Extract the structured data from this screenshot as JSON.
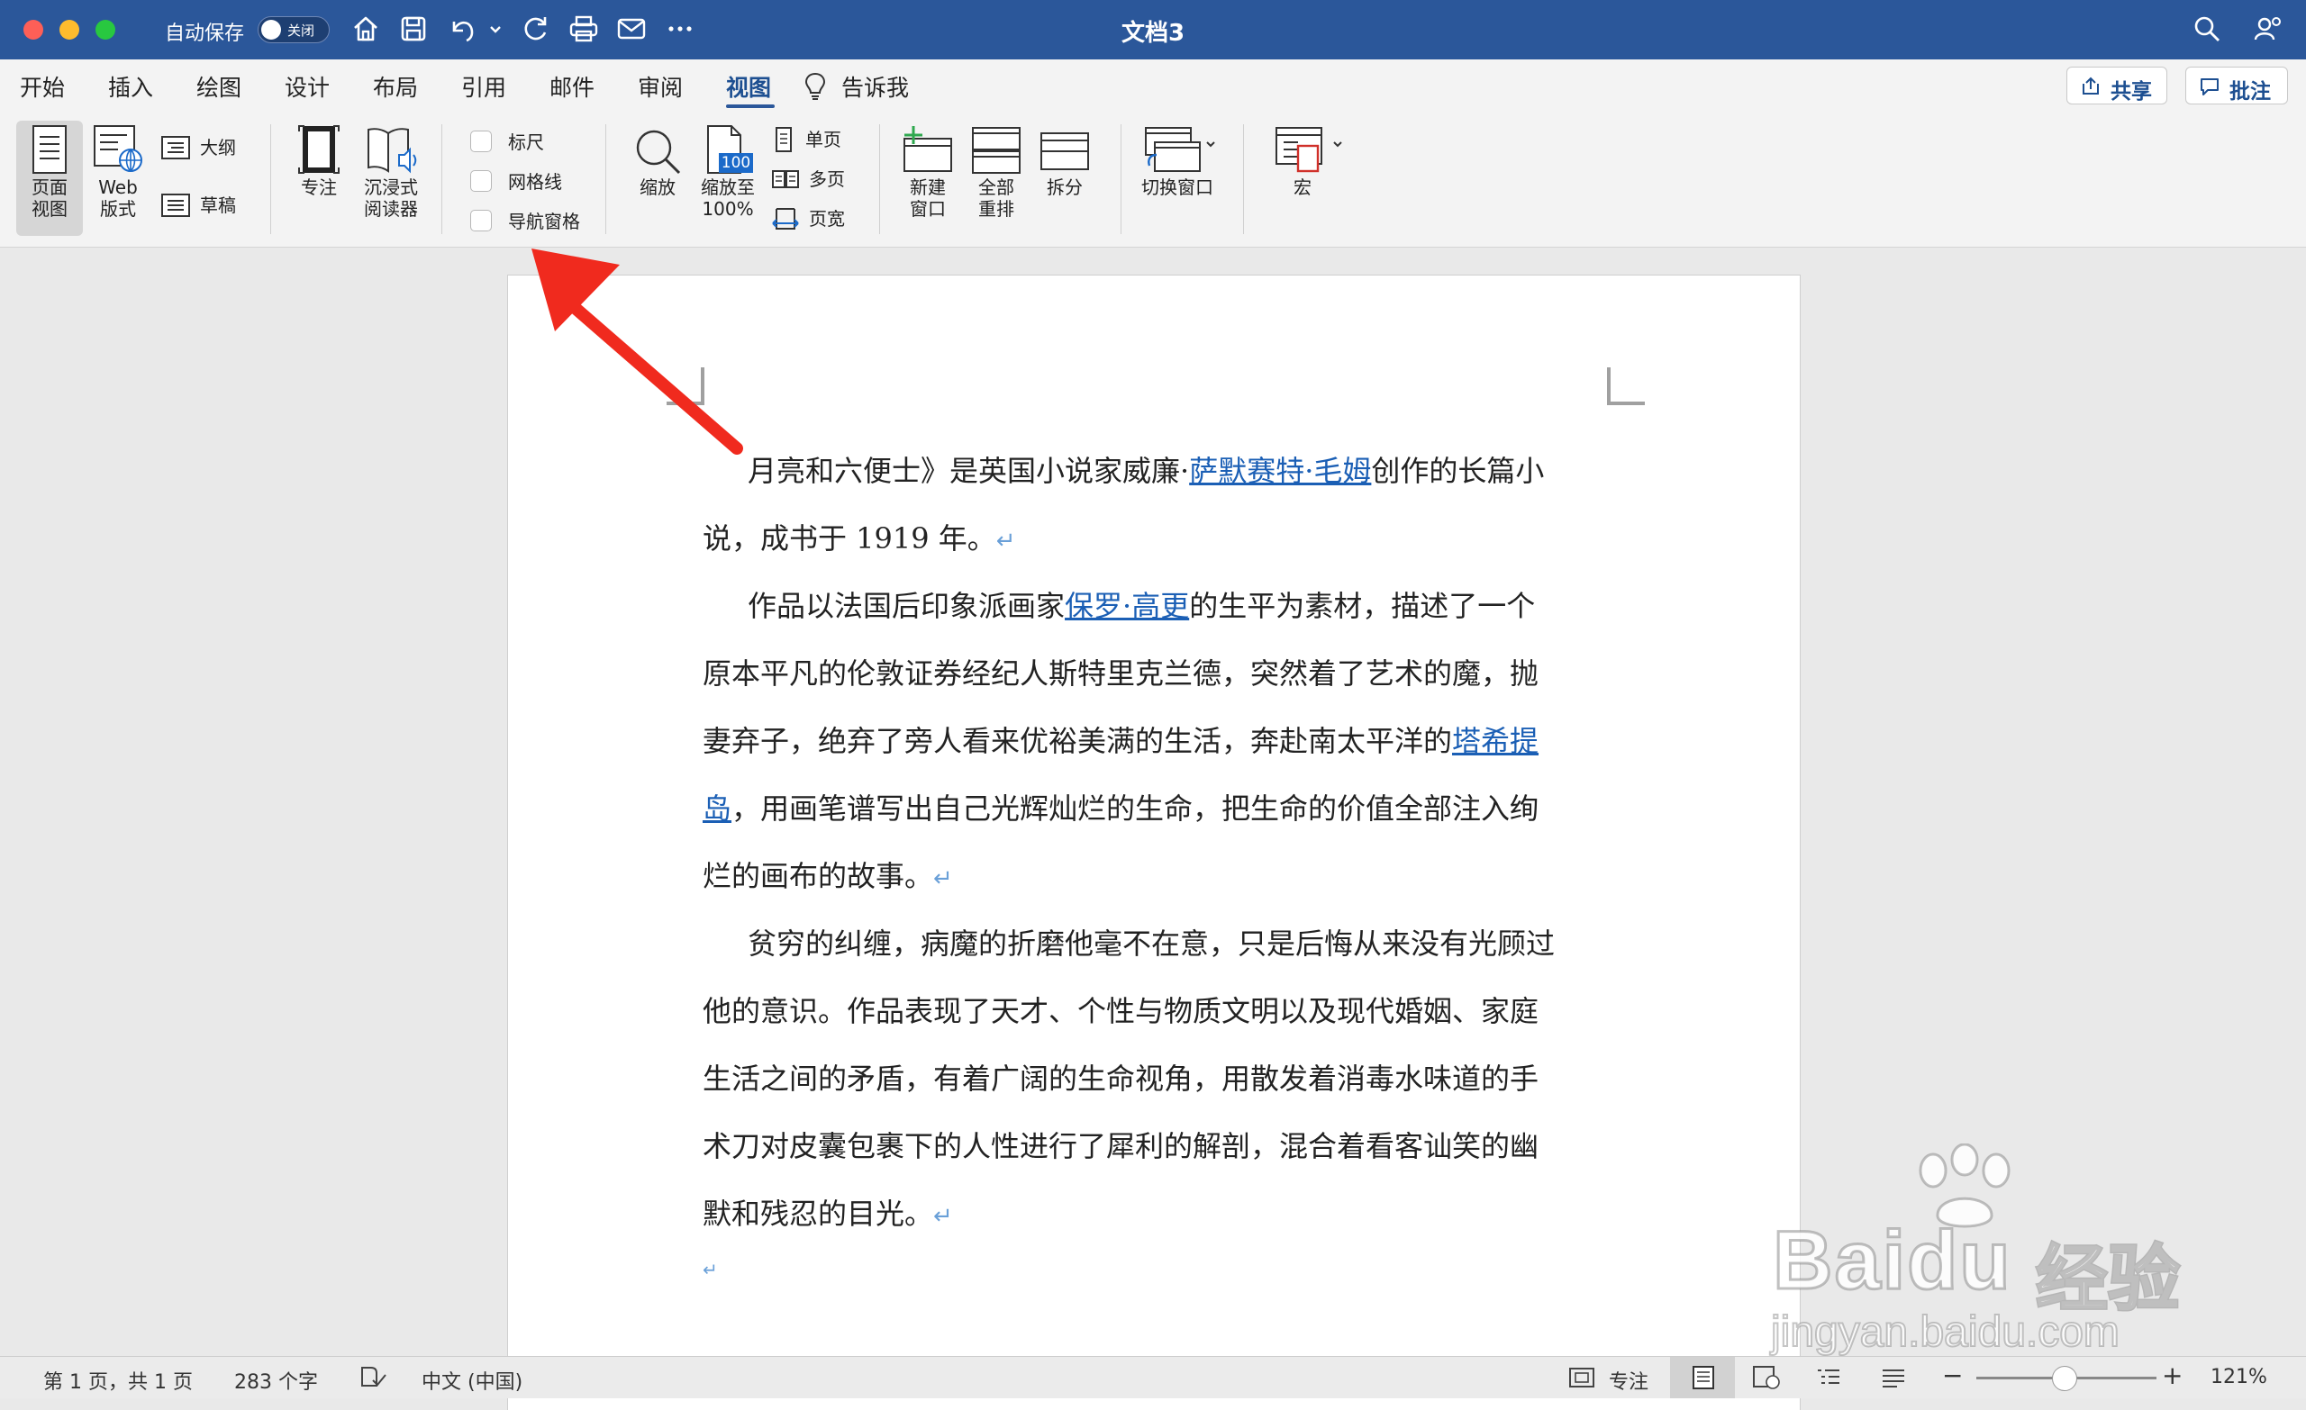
{
  "window": {
    "title": "文档3",
    "autosave_label": "自动保存",
    "autosave_state": "关闭"
  },
  "tabs": [
    "开始",
    "插入",
    "绘图",
    "设计",
    "布局",
    "引用",
    "邮件",
    "审阅",
    "视图"
  ],
  "tell_me": "告诉我",
  "share_label": "共享",
  "comments_label": "批注",
  "ribbon": {
    "page_view": "页面\n视图",
    "web_layout": "Web\n版式",
    "outline": "大纲",
    "draft": "草稿",
    "focus": "专注",
    "immersive_reader": "沉浸式\n阅读器",
    "ruler": "标尺",
    "gridlines": "网格线",
    "navigation_pane": "导航窗格",
    "zoom": "缩放",
    "zoom_100": "缩放至\n100%",
    "zoom_100_badge": "100",
    "one_page": "单页",
    "multiple_pages": "多页",
    "page_width": "页宽",
    "new_window": "新建\n窗口",
    "arrange_all": "全部\n重排",
    "split": "拆分",
    "switch_windows": "切换窗口",
    "macros": "宏"
  },
  "document": {
    "p1_a": "月亮和六便士》是英国小说家威廉·",
    "p1_link": "萨默赛特·毛姆",
    "p1_b": "创作的长篇小",
    "p1_c": "说，成书于 1919 年。",
    "p2_a": "作品以法国后印象派画家",
    "p2_link1": "保罗·高更",
    "p2_b": "的生平为素材，描述了一个",
    "p2_c": "原本平凡的伦敦证券经纪人斯特里克兰德，突然着了艺术的魔，抛",
    "p2_d": "妻弃子，绝弃了旁人看来优裕美满的生活，奔赴南太平洋的",
    "p2_link2a": "塔希提",
    "p2_link2b": "岛",
    "p2_e": "，用画笔谱写出自己光辉灿烂的生命，把生命的价值全部注入绚",
    "p2_f": "烂的画布的故事。",
    "p3_a": "贫穷的纠缠，病魔的折磨他毫不在意，只是后悔从来没有光顾过",
    "p3_b": "他的意识。作品表现了天才、个性与物质文明以及现代婚姻、家庭",
    "p3_c": "生活之间的矛盾，有着广阔的生命视角，用散发着消毒水味道的手",
    "p3_d": "术刀对皮囊包裹下的人性进行了犀利的解剖，混合着看客讪笑的幽",
    "p3_e": "默和残忍的目光。",
    "para_mark": "↵"
  },
  "status": {
    "page": "第 1 页，共 1 页",
    "words": "283 个字",
    "language": "中文 (中国)",
    "focus": "专注",
    "zoom": "121%"
  },
  "watermark": {
    "brand": "Baidu",
    "cn": "经验",
    "url": "jingyan.baidu.com"
  },
  "colors": {
    "title_bar": "#2b579a",
    "link": "#1b5fb5",
    "arrow": "#f02a1e"
  }
}
